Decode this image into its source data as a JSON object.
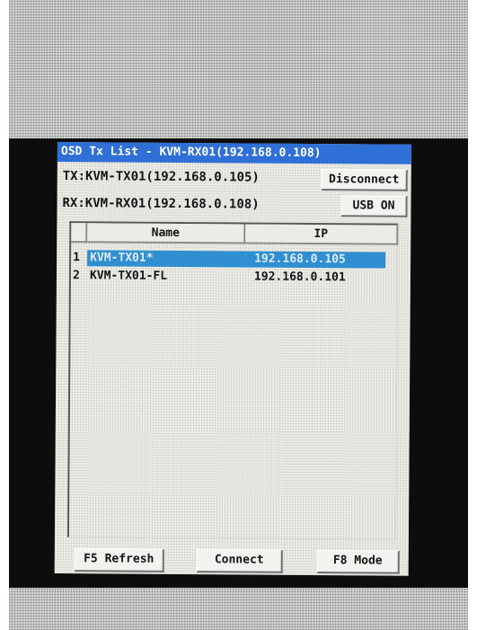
{
  "title": "OSD Tx List - KVM-RX01(192.168.0.108)",
  "tx_line": "TX:KVM-TX01(192.168.0.105)",
  "rx_line": "RX:KVM-RX01(192.168.0.108)",
  "buttons": {
    "disconnect": "Disconnect",
    "usb": "USB ON",
    "refresh": "F5 Refresh",
    "connect": "Connect",
    "mode": "F8 Mode"
  },
  "table": {
    "headers": {
      "name": "Name",
      "ip": "IP"
    },
    "rows": [
      {
        "index": "1",
        "name": "KVM-TX01*",
        "ip": "192.168.0.105",
        "selected": true
      },
      {
        "index": "2",
        "name": "KVM-TX01-FL",
        "ip": "192.168.0.101",
        "selected": false
      }
    ]
  },
  "colors": {
    "title_bar": "#2f6fd6",
    "selection": "#2f8fd0",
    "osd_background": "#efefe9"
  }
}
